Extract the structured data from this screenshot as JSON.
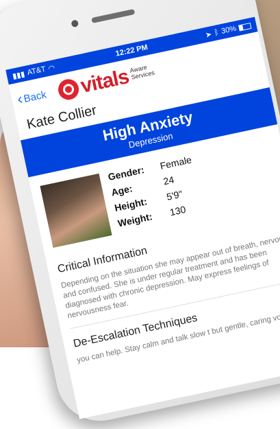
{
  "status_bar": {
    "carrier": "AT&T",
    "time": "12:22 PM",
    "battery": "30%"
  },
  "nav": {
    "back_label": "Back",
    "logo_text": "vitals",
    "logo_sub_1": "Aware",
    "logo_sub_2": "Services"
  },
  "person": {
    "name": "Kate Collier"
  },
  "banner": {
    "title": "High Anxiety",
    "subtitle": "Depression"
  },
  "profile": {
    "gender_label": "Gender:",
    "gender_value": "Female",
    "age_label": "Age:",
    "age_value": "24",
    "height_label": "Height:",
    "height_value": "5'9\"",
    "weight_label": "Weight:",
    "weight_value": "130"
  },
  "critical": {
    "title": "Critical Information",
    "text": "Depending on the situation she may appear out of breath, nervous and confused. She is under regular treatment and has been diagnosed with chronic depression. May express feelings of nervousness fear."
  },
  "deescalation": {
    "title": "De-Escalation Techniques",
    "text": "you can help. Stay calm and talk slow t but gentle, caring voice"
  },
  "colors": {
    "brand_blue": "#0044dd",
    "brand_red": "#d11f2a",
    "link_blue": "#1a6cf2"
  }
}
